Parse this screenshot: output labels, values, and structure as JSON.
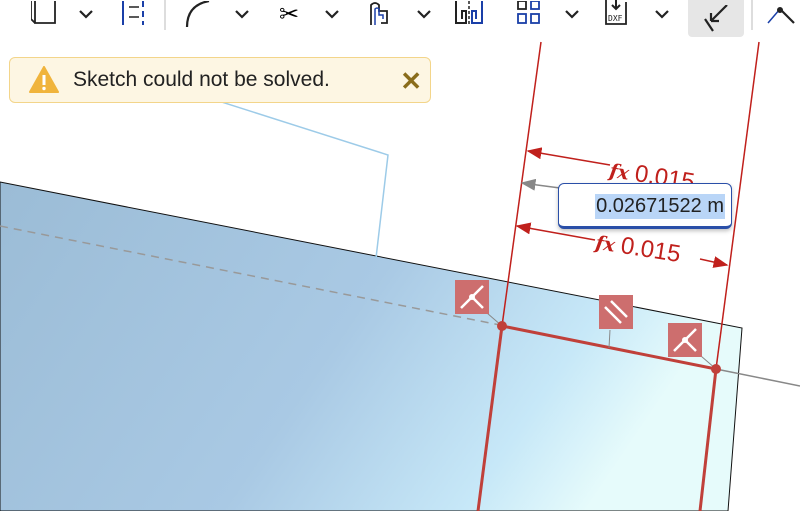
{
  "toolbar": {
    "tools": [
      "extrude-view",
      "dimension-offset",
      "fillet-arc",
      "trim",
      "offset",
      "mirror",
      "pattern",
      "export-dxf",
      "dimension",
      "point"
    ],
    "active_tool": "dimension"
  },
  "toast": {
    "message": "Sketch could not be solved.",
    "close_label": "✕"
  },
  "dimensions": {
    "input_value": "0.02671522 m",
    "top_value": "0.015",
    "bottom_value": "0.015",
    "fx_label": "fx"
  },
  "colors": {
    "constraint_red": "#c0201c",
    "face_blue": "#a8cbe6",
    "toast_bg": "#fdf6e3",
    "warning": "#f0b43c"
  }
}
